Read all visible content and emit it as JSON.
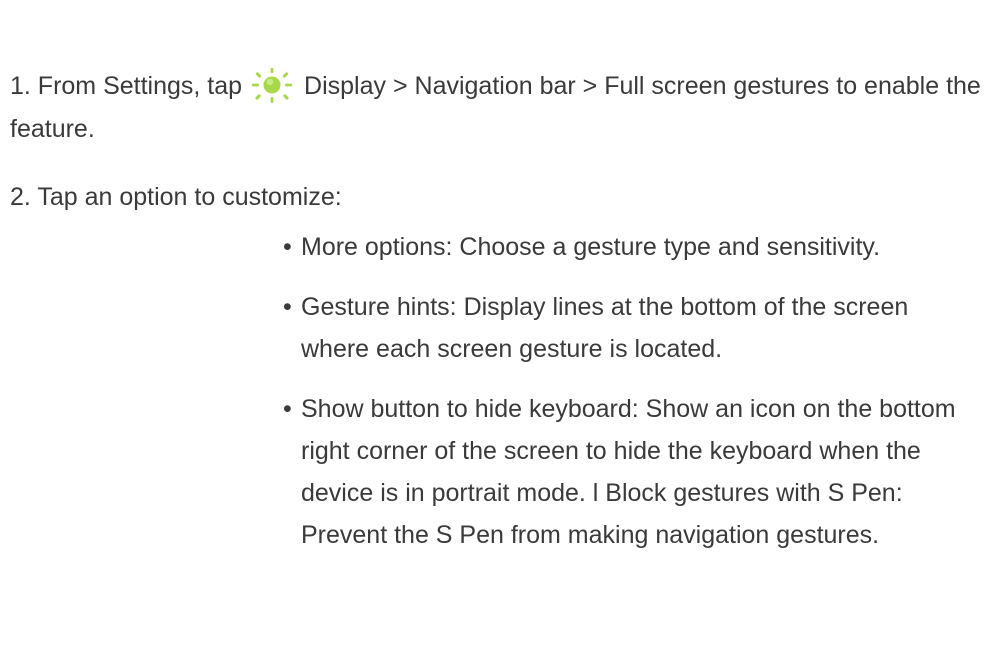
{
  "steps": {
    "step1": {
      "before_icon": "1. From Settings, tap",
      "icon": "display-brightness-icon",
      "after_icon": "Display > Navigation bar > Full screen gestures to enable the feature."
    },
    "step2": {
      "text": "2. Tap an option to customize:"
    }
  },
  "bullet_char": "•",
  "options": [
    {
      "text": "More options: Choose a gesture type and sensitivity."
    },
    {
      "text": "Gesture hints: Display lines at the bottom of the screen where each screen gesture is located."
    },
    {
      "text": "Show button to hide keyboard: Show an icon on the bottom right corner of the screen to hide the keyboard when the device is in portrait mode. l Block gestures with S Pen: Prevent the S Pen from making navigation gestures."
    }
  ],
  "colors": {
    "text": "#3a3a3a",
    "icon_green": "#a6d84a",
    "icon_green_light": "#c6ea86"
  }
}
